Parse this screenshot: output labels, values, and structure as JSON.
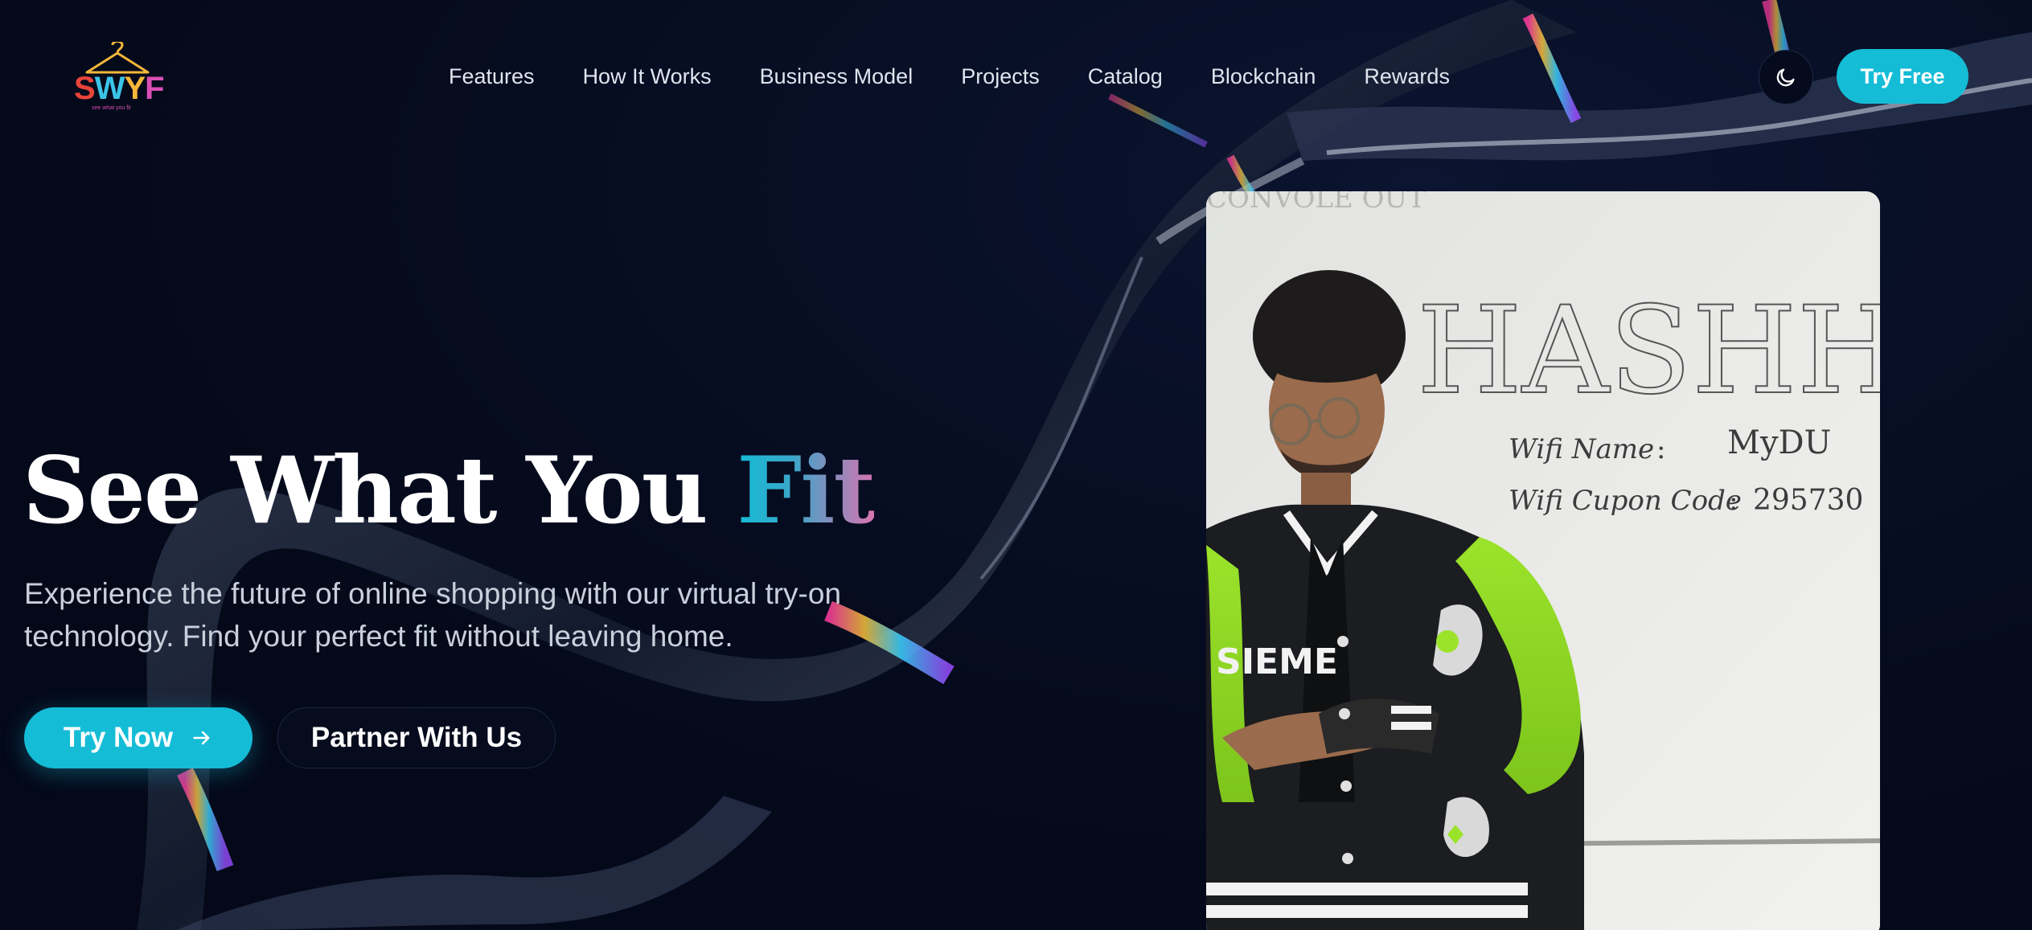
{
  "brand": {
    "logo_text": [
      "S",
      "W",
      "Y",
      "F"
    ],
    "logo_tagline": "see what you fit",
    "colors": {
      "s": "#e8443a",
      "w": "#3cc4e8",
      "y": "#f4b73a",
      "f": "#d94fb5"
    }
  },
  "nav": {
    "items": [
      {
        "label": "Features"
      },
      {
        "label": "How It Works"
      },
      {
        "label": "Business Model"
      },
      {
        "label": "Projects"
      },
      {
        "label": "Catalog"
      },
      {
        "label": "Blockchain"
      },
      {
        "label": "Rewards"
      }
    ],
    "theme_toggle_icon": "moon-icon",
    "cta_label": "Try Free"
  },
  "hero": {
    "title_main": "See What You ",
    "title_accent": "Fit",
    "subtitle": "Experience the future of online shopping with our virtual try-on technology. Find your perfect fit without leaving home.",
    "primary_button": "Try Now",
    "primary_button_icon": "arrow-right-icon",
    "secondary_button": "Partner With Us"
  },
  "photo": {
    "board_heading": "HASHHACK",
    "board_line1_label": "Wifi Name",
    "board_line1_value": "MyDU",
    "board_line2_label": "Wifi Cupon Code",
    "board_line2_value": "295730",
    "board_top_text": "CONVOLE OUT",
    "jacket_text": "SIEME"
  },
  "colors": {
    "background": "#050a1c",
    "accent": "#14bcd6",
    "text": "#ffffff",
    "muted_text": "#c9d0dc"
  }
}
